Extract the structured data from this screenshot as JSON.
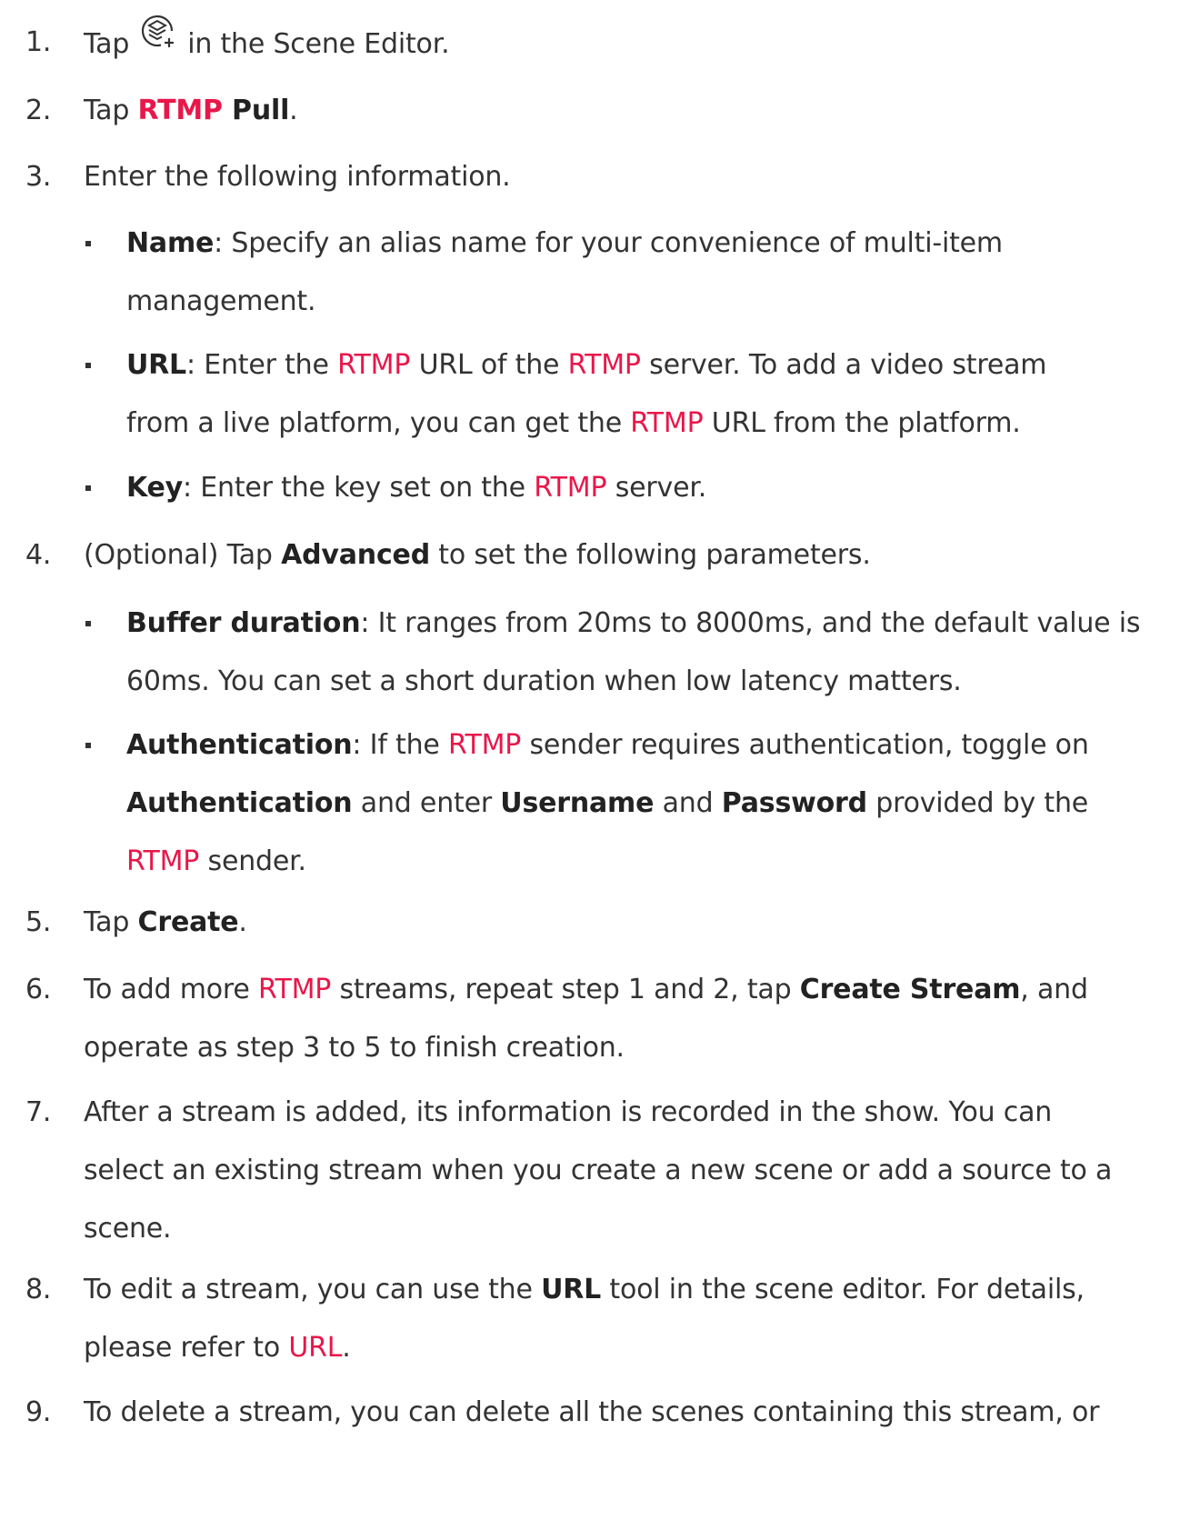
{
  "steps": [
    {
      "num": "1.",
      "pre": "Tap",
      "post": "in the Scene Editor."
    },
    {
      "num": "2.",
      "pre": "Tap ",
      "hl": "RTMP",
      "bold": " Pull",
      "post": "."
    },
    {
      "num": "3.",
      "text": "Enter the following information."
    },
    {
      "num": "4.",
      "pre": "(Optional) Tap ",
      "bold": "Advanced",
      "post": " to set the following parameters."
    },
    {
      "num": "5.",
      "pre": "Tap ",
      "bold": "Create",
      "post": "."
    },
    {
      "num": "6.",
      "pre": "To add more ",
      "hl": "RTMP",
      "mid": " streams, repeat step 1 and 2, tap ",
      "bold": "Create Stream",
      "post": ", and",
      "line2": "operate as step 3 to 5 to finish creation."
    },
    {
      "num": "7.",
      "line1": "After a stream is added, its information is recorded in the show. You can",
      "line2": "select an existing stream when you create a new scene or add a source to a",
      "line3": "scene."
    },
    {
      "num": "8.",
      "pre": "To edit a stream, you can use the ",
      "bold": "URL",
      "post": " tool in the scene editor. For details,",
      "line2a": "please refer to ",
      "link": "URL",
      "line2b": "."
    },
    {
      "num": "9.",
      "text": "To delete a stream, you can delete all the scenes containing this stream, or"
    }
  ],
  "step3_bullets": [
    {
      "term": "Name",
      "line1": ": Specify an alias name for your convenience of multi-item",
      "line2": "management."
    },
    {
      "term": "URL",
      "a": ": Enter the ",
      "h1": "RTMP",
      "b": " URL of the ",
      "h2": "RTMP",
      "c": " server. To add a video stream",
      "d": "from a live platform, you can get the ",
      "h3": "RTMP",
      "e": " URL from the platform."
    },
    {
      "term": "Key",
      "a": ": Enter the key set on the ",
      "h1": "RTMP",
      "b": " server."
    }
  ],
  "step4_bullets": [
    {
      "term": "Buffer duration",
      "line1": ": It ranges from 20ms to 8000ms, and the default value is",
      "line2": "60ms. You can set a short duration when low latency matters."
    },
    {
      "term": "Authentication",
      "a": ": If the ",
      "h1": "RTMP",
      "b": " sender requires authentication, toggle on",
      "t2": "Authentication",
      "c": " and enter ",
      "t3": "Username",
      "d": " and ",
      "t4": "Password",
      "e": " provided by the",
      "h2": "RTMP",
      "f": " sender."
    }
  ],
  "icons": {
    "add_source": "layers-add-icon"
  },
  "colors": {
    "accent": "#e8174a",
    "text": "#333333"
  }
}
